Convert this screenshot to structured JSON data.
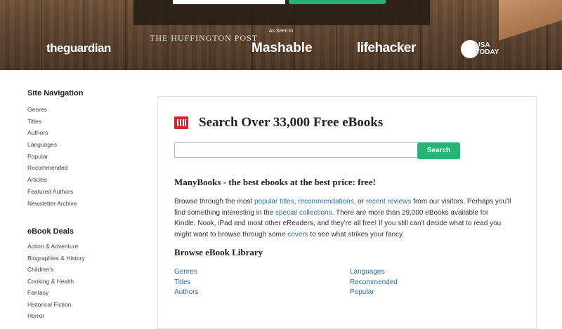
{
  "header": {
    "seen_in": "As Seen In",
    "logos": {
      "guardian": "theguardian",
      "huffington": "THE HUFFINGTON POST",
      "mashable": "Mashable",
      "lifehacker": "lifehacker",
      "usa_today_line1": "USA",
      "usa_today_line2": "TODAY"
    }
  },
  "sidebar": {
    "nav_heading": "Site Navigation",
    "nav_items": [
      "Genres",
      "Titles",
      "Authors",
      "Languages",
      "Popular",
      "Recommended",
      "Articles",
      "Featured Authors",
      "Newsletter Archive"
    ],
    "deals_heading": "eBook Deals",
    "deal_items": [
      "Action & Adventure",
      "Biographies & History",
      "Children's",
      "Cooking & Health",
      "Fantasy",
      "Historical Fiction",
      "Horror"
    ]
  },
  "main": {
    "title": "Search Over 33,000 Free eBooks",
    "search": {
      "value": "",
      "placeholder": "",
      "button_label": "Search"
    },
    "tagline": "ManyBooks - the best ebooks at the best price: free!",
    "intro": {
      "t1": "Browse through the most ",
      "link1": "popular titles",
      "t2": ", ",
      "link2": "recommendations",
      "t3": ", or ",
      "link3": "recent reviews",
      "t4": " from our visitors. Perhaps you'll find something interesting in the ",
      "link4": "special collections",
      "t5": ". There are more than 29,000 eBooks available for Kindle, Nook, iPad and most other eReaders, and they're all free! If you still can't decide what to read you might want to browse through some ",
      "link5": "covers",
      "t6": " to see what strikes your fancy."
    },
    "library_heading": "Browse eBook Library",
    "library_left": [
      "Genres",
      "Titles",
      "Authors"
    ],
    "library_right": [
      "Languages",
      "Recommended",
      "Popular"
    ]
  },
  "colors": {
    "accent_green": "#22b573",
    "link_blue": "#2a6db3",
    "icon_red": "#d9252a"
  }
}
